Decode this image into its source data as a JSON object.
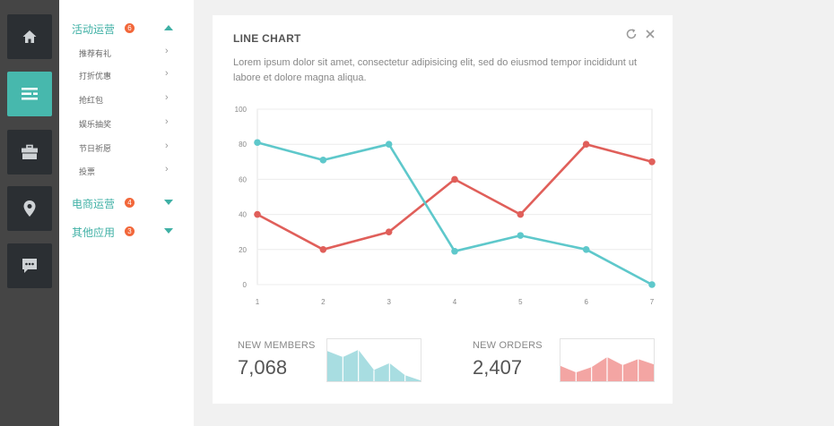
{
  "rail": {
    "items": [
      {
        "icon": "home-icon",
        "active": false
      },
      {
        "icon": "list-icon",
        "active": true
      },
      {
        "icon": "briefcase-icon",
        "active": false
      },
      {
        "icon": "map-pin-icon",
        "active": false
      },
      {
        "icon": "chat-icon",
        "active": false
      }
    ]
  },
  "nav": {
    "groups": [
      {
        "label": "活动运营",
        "badge": "6",
        "expanded": true
      },
      {
        "label": "电商运营",
        "badge": "4",
        "expanded": false
      },
      {
        "label": "其他应用",
        "badge": "3",
        "expanded": false
      }
    ],
    "subitems": [
      "推荐有礼",
      "打折优惠",
      "抢红包",
      "娱乐抽奖",
      "节日祈愿",
      "投票"
    ]
  },
  "card": {
    "title": "LINE CHART",
    "description": "Lorem ipsum dolor sit amet, consectetur adipisicing elit, sed do eiusmod tempor incididunt ut labore et dolore magna aliqua."
  },
  "chart_data": {
    "type": "line",
    "x": [
      1,
      2,
      3,
      4,
      5,
      6,
      7
    ],
    "series": [
      {
        "values": [
          40,
          20,
          30,
          60,
          40,
          80,
          70
        ],
        "color": "#e05f5a"
      },
      {
        "values": [
          81,
          71,
          80,
          19,
          28,
          20,
          0
        ],
        "color": "#5ec8cb"
      }
    ],
    "ylim": [
      0,
      100
    ],
    "yticks": [
      0,
      20,
      40,
      60,
      80,
      100
    ],
    "grid": true
  },
  "stats": [
    {
      "label": "NEW MEMBERS",
      "value": "7,068",
      "spark": [
        75,
        60,
        78,
        28,
        45,
        15,
        2
      ],
      "color": "#a8dde1"
    },
    {
      "label": "NEW ORDERS",
      "value": "2,407",
      "spark": [
        38,
        22,
        35,
        60,
        40,
        55,
        42
      ],
      "color": "#f3a5a3"
    }
  ]
}
